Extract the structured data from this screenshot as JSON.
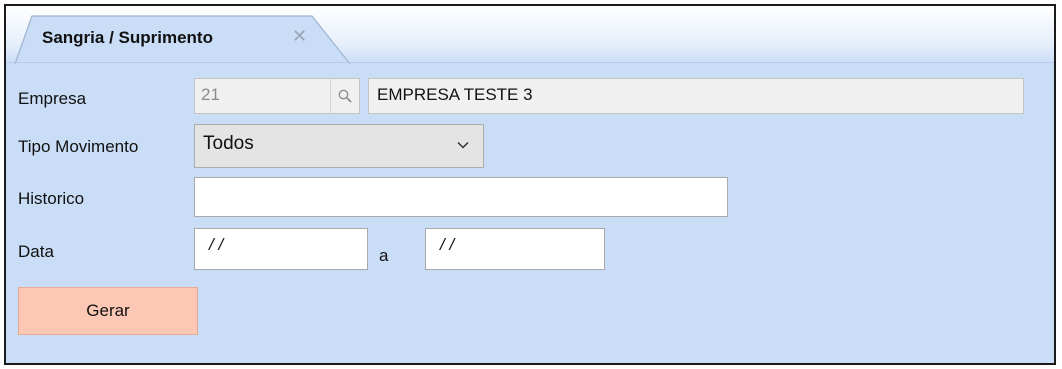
{
  "tab": {
    "title": "Sangria / Suprimento",
    "close_glyph": "✕"
  },
  "form": {
    "empresa": {
      "label": "Empresa",
      "code": "21",
      "description": "EMPRESA TESTE 3"
    },
    "tipo_movimento": {
      "label": "Tipo Movimento",
      "selected": "Todos"
    },
    "historico": {
      "label": "Historico",
      "value": ""
    },
    "data": {
      "label": "Data",
      "from": "/ /",
      "separator": "a",
      "to": "/ /"
    }
  },
  "actions": {
    "gerar_label": "Gerar"
  },
  "colors": {
    "background": "#c9ddf7",
    "primary_button": "#fcc7b4",
    "frame_border": "#1a1a1a"
  },
  "icons": {
    "search": "search-icon",
    "dropdown": "chevron-down-icon",
    "close": "close-icon"
  }
}
